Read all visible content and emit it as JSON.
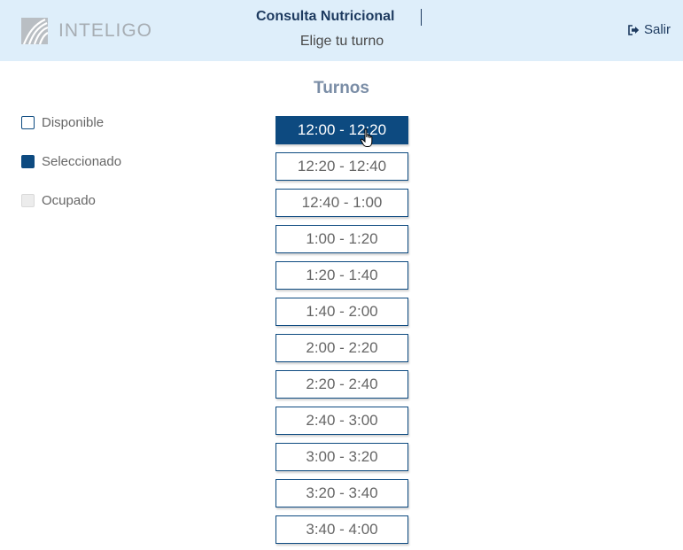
{
  "header": {
    "logo_text": "INTELIGO",
    "title": "Consulta Nutricional",
    "subtitle": "Elige tu turno",
    "logout_label": "Salir",
    "logout_icon": "sign-out-icon"
  },
  "legend": [
    {
      "label": "Disponible",
      "state": "available"
    },
    {
      "label": "Seleccionado",
      "state": "selected"
    },
    {
      "label": "Ocupado",
      "state": "busy"
    }
  ],
  "turnos": {
    "title": "Turnos",
    "selected_index": 0,
    "slots": [
      "12:00 - 12:20",
      "12:20 - 12:40",
      "12:40 - 1:00",
      "1:00 - 1:20",
      "1:20 - 1:40",
      "1:40 - 2:00",
      "2:00 - 2:20",
      "2:20 - 2:40",
      "2:40 - 3:00",
      "3:00 - 3:20",
      "3:20 - 3:40",
      "3:40 - 4:00"
    ]
  },
  "colors": {
    "header_bg": "#deeefa",
    "primary": "#0d4a80",
    "title": "#1d3a5f",
    "turnos_title": "#7a8da6",
    "busy": "#ececec"
  }
}
